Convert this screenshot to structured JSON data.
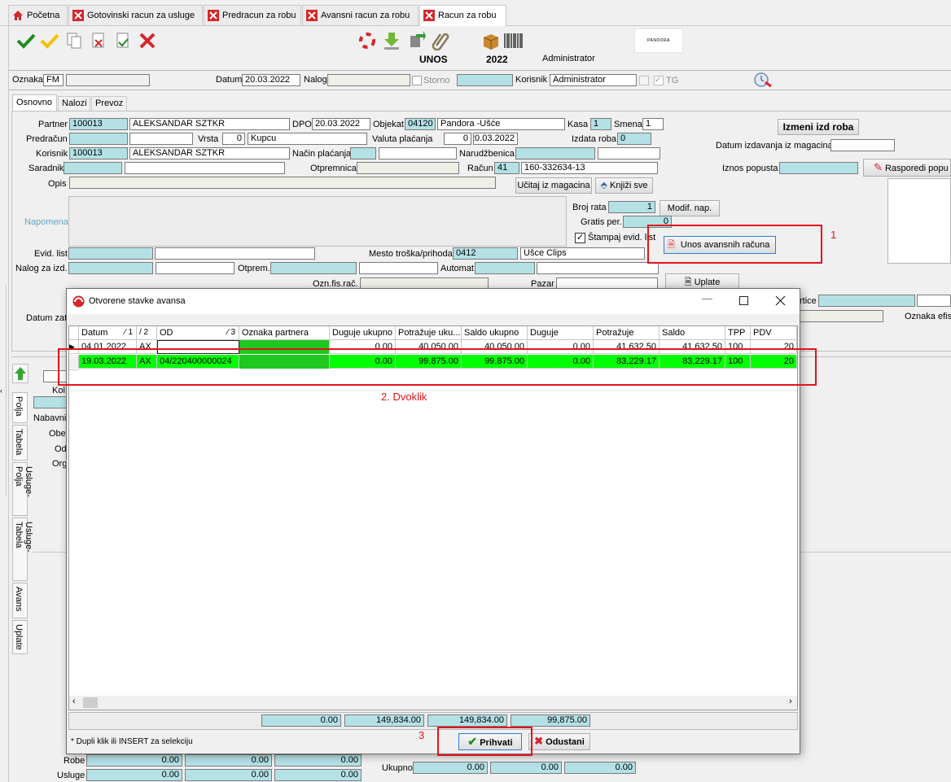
{
  "tabs": [
    {
      "label": "Početna",
      "icon": "home-icon"
    },
    {
      "label": "Gotovinski racun za usluge",
      "icon": "close-icon"
    },
    {
      "label": "Predracun za robu",
      "icon": "close-icon"
    },
    {
      "label": "Avansni racun za robu",
      "icon": "close-icon"
    },
    {
      "label": "Racun za robu",
      "icon": "close-icon"
    }
  ],
  "toolbar": {
    "unos_label": "UNOS",
    "year": "2022",
    "user": "Administrator",
    "logo_text": "PANDORA"
  },
  "header": {
    "oznaka_label": "Oznaka",
    "oznaka_value": "FM",
    "datum_label": "Datum",
    "datum_value": "20.03.2022",
    "nalog_label": "Nalog",
    "storno_label": "Storno",
    "korisnik_label": "Korisnik",
    "korisnik_value": "Administrator",
    "tg_label": "TG"
  },
  "form_tabs": [
    "Osnovno",
    "Nalozi",
    "Prevoz"
  ],
  "form": {
    "partner_label": "Partner",
    "partner_code": "100013",
    "partner_name": "ALEKSANDAR SZTKR",
    "dpo_label": "DPO",
    "dpo_value": "20.03.2022",
    "objekat_label": "Objekat",
    "objekat_code": "04120",
    "objekat_name": "Pandora -Ušće",
    "kasa_label": "Kasa",
    "kasa_value": "1",
    "smena_label": "Smena",
    "smena_value": "1",
    "izmeni_button": "Izmeni izd roba",
    "predracun_label": "Predračun",
    "vrsta_label": "Vrsta",
    "vrsta_value": "0",
    "vrsta_name": "Kupcu",
    "valuta_label": "Valuta plaćanja",
    "valuta_days": "0",
    "valuta_date": "20.03.2022",
    "izdata_label": "Izdata roba",
    "izdata_value": "0",
    "datum_izd_label": "Datum izdavanja iz magacina",
    "korisnik_label": "Korisnik",
    "korisnik_code": "100013",
    "korisnik_name": "ALEKSANDAR SZTKR",
    "nacin_label": "Način plaćanja",
    "narudzbenica_label": "Narudžbenica",
    "saradnik_label": "Saradnik",
    "otpremnica_label": "Otpremnica",
    "racun_label": "Račun",
    "racun_code": "41",
    "racun_value": "160-332634-13",
    "iznos_label": "Iznos popusta",
    "rasporedi_button": "Rasporedi popu",
    "opis_label": "Opis",
    "ucitaj_button": "Učitaj iz magacina",
    "knjizi_button": "Knjiži sve",
    "napomena_label": "Napomena",
    "broj_rata_label": "Broj rata",
    "broj_rata_value": "1",
    "modif_button": "Modif. nap.",
    "gratis_label": "Gratis per.",
    "gratis_value": "0",
    "stampaj_label": "Štampaj evid. list",
    "avans_button": "Unos avansnih računa",
    "evid_label": "Evid. list",
    "mesto_label": "Mesto troška/prihoda",
    "mesto_code": "0412",
    "mesto_name": "Ušce Clips",
    "nalog_izd_label": "Nalog za izd.",
    "otprem_label": "Otprem.",
    "automat_label": "Automat",
    "ozn_fis_label": "Ozn.fis.rač.",
    "pazar_label": "Pazar",
    "uplate_button": "Uplate",
    "datum_zat_label": "Datum zat",
    "artice_label": "rtice",
    "oznaka_efis_label": "Oznaka efis"
  },
  "side_tabs": [
    "Polja",
    "Tabela",
    "Usluge-Polja",
    "Usluge-Tabela",
    "Avans",
    "Uplate"
  ],
  "left_panel": [
    "Kol",
    "Nabavni",
    "Obe",
    "Od",
    "Org"
  ],
  "bottom": {
    "robe_label": "Robe",
    "usluge_label": "Usluge",
    "robe_values": [
      "0.00",
      "0.00",
      "0.00"
    ],
    "usluge_values": [
      "0.00",
      "0.00",
      "0.00"
    ],
    "ukupno_label": "Ukupno",
    "ukupno_values": [
      "0.00",
      "0.00",
      "0.00"
    ]
  },
  "annotations": {
    "one": "1",
    "two": "2. Dvoklik",
    "three": "3"
  },
  "modal": {
    "title": "Otvorene stavke avansa",
    "columns": [
      "Datum",
      "/ 2",
      "OD",
      "Oznaka partnera",
      "Duguje ukupno",
      "Potražuje uku...",
      "Saldo ukupno",
      "Duguje",
      "Potražuje",
      "Saldo",
      "TPP",
      "PDV"
    ],
    "sort_marks": [
      "1",
      "3"
    ],
    "rows": [
      [
        "04.01.2022",
        "AX",
        "",
        "",
        "0.00",
        "40,050.00",
        "40,050.00",
        "0.00",
        "41,632.50",
        "41,632.50",
        "100",
        "20"
      ],
      [
        "19.03.2022",
        "AX",
        "04/220400000024",
        "",
        "0.00",
        "99,875.00",
        "99,875.00",
        "0.00",
        "83,229.17",
        "83,229.17",
        "100",
        "20"
      ]
    ],
    "totals": [
      "0.00",
      "149,834.00",
      "149,834.00",
      "99,875.00"
    ],
    "hint": "* Dupli klik ili INSERT za selekciju",
    "accept_button": "Prihvati",
    "cancel_button": "Odustani",
    "colors": {
      "selected_row": "#00ff00",
      "partner_cell": "#1fc71f"
    }
  }
}
